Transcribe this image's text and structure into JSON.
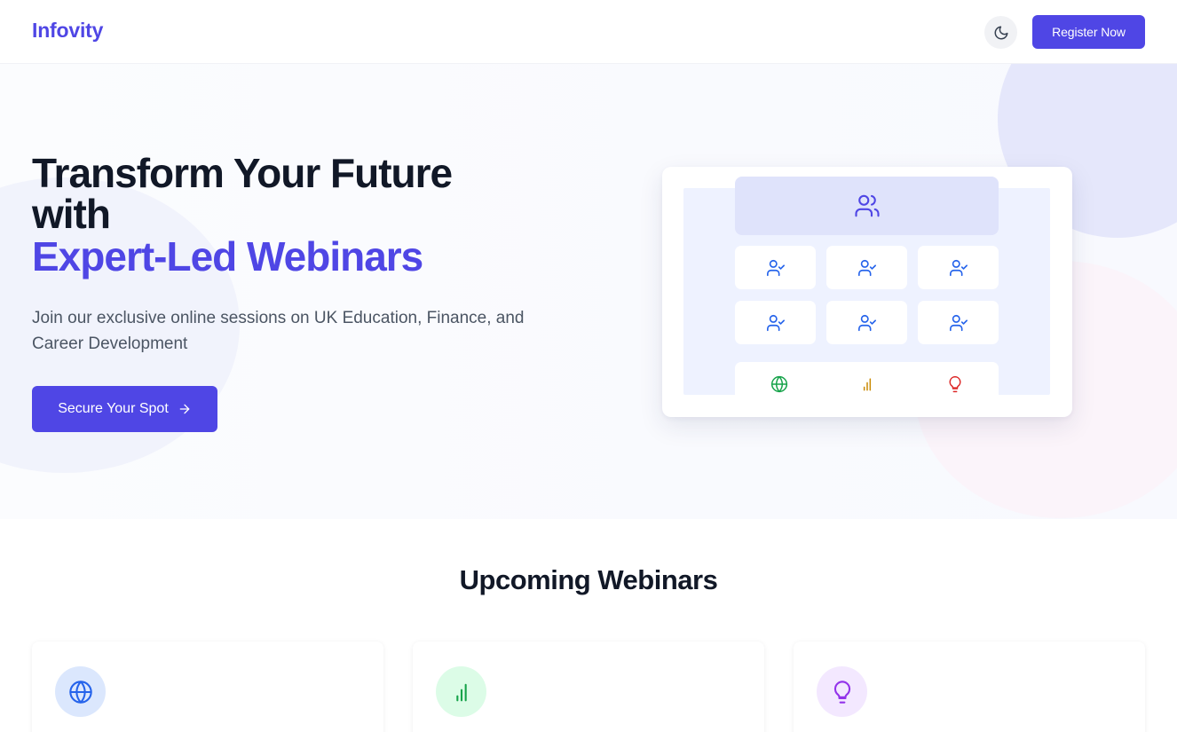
{
  "header": {
    "brand": "Infovity",
    "theme_toggle_icon": "moon-icon",
    "register_label": "Register Now"
  },
  "hero": {
    "title_line1": "Transform Your Future",
    "title_line2": "with",
    "title_accent": "Expert-Led Webinars",
    "subtitle": "Join our exclusive online sessions on UK Education, Finance, and Career Development",
    "cta_label": "Secure Your Spot",
    "cta_icon": "arrow-right-icon"
  },
  "illustration": {
    "top_icon": "users-icon",
    "tile_icon": "user-check-icon",
    "tile_count": 6,
    "bottom_icons": [
      "globe-icon",
      "bar-chart-icon",
      "lightbulb-icon"
    ]
  },
  "upcoming": {
    "title": "Upcoming Webinars",
    "cards": [
      {
        "icon": "globe-icon",
        "accent": "#2563eb",
        "bg": "#dbe7fd"
      },
      {
        "icon": "bar-chart-icon",
        "accent": "#16a34a",
        "bg": "#dcfce7"
      },
      {
        "icon": "lightbulb-icon",
        "accent": "#9333ea",
        "bg": "#f3e8ff"
      }
    ]
  },
  "colors": {
    "brand": "#4f46e5",
    "heading": "#111827",
    "body": "#4b5563",
    "globe_green": "#16a34a",
    "chart_amber": "#ca8a04",
    "bulb_red": "#dc2626",
    "user_blue": "#2563eb"
  }
}
